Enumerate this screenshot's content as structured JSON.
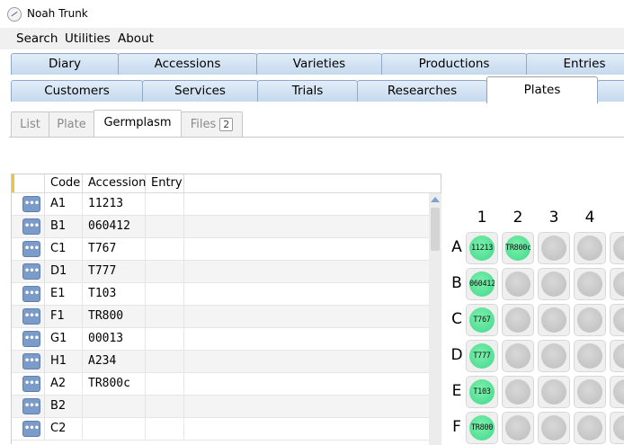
{
  "window": {
    "title": "Noah  Trunk"
  },
  "menu": [
    "Search",
    "Utilities",
    "About"
  ],
  "tabs_row1": [
    "Diary",
    "Accessions",
    "Varieties",
    "Productions",
    "Entries"
  ],
  "tabs_row2": [
    "Customers",
    "Services",
    "Trials",
    "Researches",
    "Plates"
  ],
  "active_tab": "Plates",
  "subtabs": [
    {
      "label": "List"
    },
    {
      "label": "Plate"
    },
    {
      "label": "Germplasm",
      "active": true
    },
    {
      "label": "Files",
      "badge": "2"
    }
  ],
  "grid": {
    "columns": [
      "Code",
      "Accession",
      "Entry"
    ],
    "rows": [
      {
        "code": "A1",
        "accession": "11213",
        "entry": ""
      },
      {
        "code": "B1",
        "accession": "060412",
        "entry": ""
      },
      {
        "code": "C1",
        "accession": "T767",
        "entry": ""
      },
      {
        "code": "D1",
        "accession": "T777",
        "entry": ""
      },
      {
        "code": "E1",
        "accession": "T103",
        "entry": ""
      },
      {
        "code": "F1",
        "accession": "TR800",
        "entry": ""
      },
      {
        "code": "G1",
        "accession": "00013",
        "entry": ""
      },
      {
        "code": "H1",
        "accession": "A234",
        "entry": ""
      },
      {
        "code": "A2",
        "accession": "TR800c",
        "entry": ""
      },
      {
        "code": "B2",
        "accession": "",
        "entry": ""
      },
      {
        "code": "C2",
        "accession": "",
        "entry": ""
      }
    ],
    "row_button_label": "•••"
  },
  "plate": {
    "columns": [
      "1",
      "2",
      "3",
      "4"
    ],
    "rows": [
      "A",
      "B",
      "C",
      "D",
      "E",
      "F"
    ],
    "wells": {
      "A1": "11213",
      "A2": "TR800c",
      "B1": "060412",
      "C1": "T767",
      "D1": "T777",
      "E1": "T103",
      "F1": "TR800"
    },
    "colors": {
      "filled": "#3fd88a",
      "empty": "#c4c4c4"
    }
  }
}
